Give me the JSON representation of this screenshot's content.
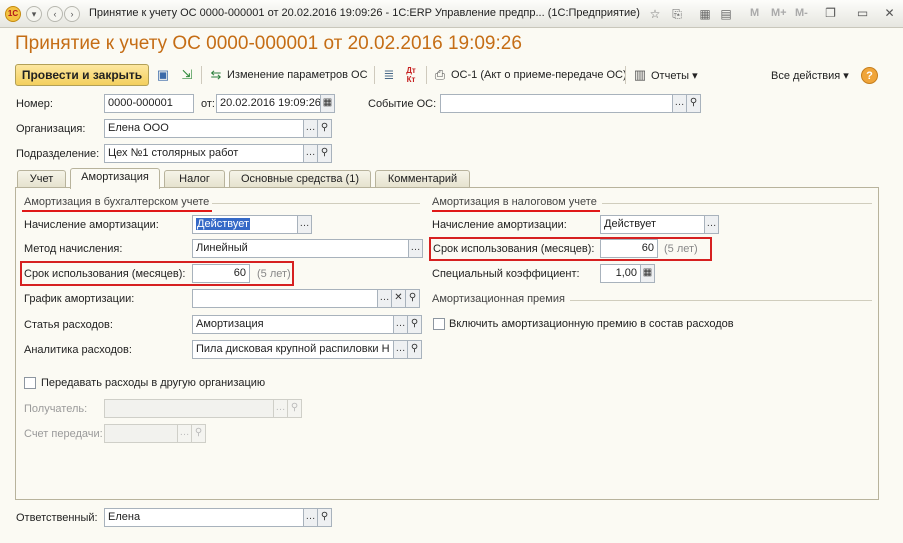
{
  "titlebar": {
    "text": "Принятие к учету ОС 0000-000001 от 20.02.2016 19:09:26 - 1С:ERP Управление предпр...  (1С:Предприятие)",
    "logo": "1С",
    "letters": [
      "M",
      "M+",
      "M-"
    ]
  },
  "header": {
    "title": "Принятие к учету ОС 0000-000001 от 20.02.2016 19:09:26"
  },
  "toolbar": {
    "post_close": "Провести и закрыть",
    "change_params": "Изменение параметров ОС",
    "dt_kt": "Дт Кт",
    "os1": "ОС-1 (Акт о приеме-передаче ОС)",
    "reports": "Отчеты",
    "all_actions": "Все действия",
    "help": "?"
  },
  "fields": {
    "number_label": "Номер:",
    "number_value": "0000-000001",
    "date_label": "от:",
    "date_value": "20.02.2016 19:09:26",
    "event_label": "Событие ОС:",
    "event_value": "",
    "org_label": "Организация:",
    "org_value": "Елена ООО",
    "dept_label": "Подразделение:",
    "dept_value": "Цех №1 столярных работ",
    "responsible_label": "Ответственный:",
    "responsible_value": "Елена"
  },
  "tabs": [
    "Учет",
    "Амортизация",
    "Налог",
    "Основные средства (1)",
    "Комментарий"
  ],
  "accounting": {
    "title": "Амортизация в бухгалтерском учете",
    "accrual_label": "Начисление амортизации:",
    "accrual_value": "Действует",
    "method_label": "Метод начисления:",
    "method_value": "Линейный",
    "term_label": "Срок использования (месяцев):",
    "term_value": "60",
    "term_years": "(5 лет)",
    "schedule_label": "График амортизации:",
    "schedule_value": "",
    "expense_label": "Статья расходов:",
    "expense_value": "Амортизация",
    "analytics_label": "Аналитика расходов:",
    "analytics_value": "Пила дисковая крупной распиловки Н",
    "transfer_label": "Передавать расходы в другую организацию",
    "recipient_label": "Получатель:",
    "account_label": "Счет передачи:"
  },
  "tax": {
    "title": "Амортизация в налоговом учете",
    "accrual_label": "Начисление амортизации:",
    "accrual_value": "Действует",
    "term_label": "Срок использования (месяцев):",
    "term_value": "60",
    "term_years": "(5 лет)",
    "coef_label": "Специальный коэффициент:",
    "coef_value": "1,00",
    "bonus_title": "Амортизационная премия",
    "bonus_label": "Включить амортизационную премию в состав расходов"
  },
  "icons": [
    "dots-icon",
    "search-icon",
    "calendar-icon",
    "clear-icon",
    "calculator-icon"
  ]
}
